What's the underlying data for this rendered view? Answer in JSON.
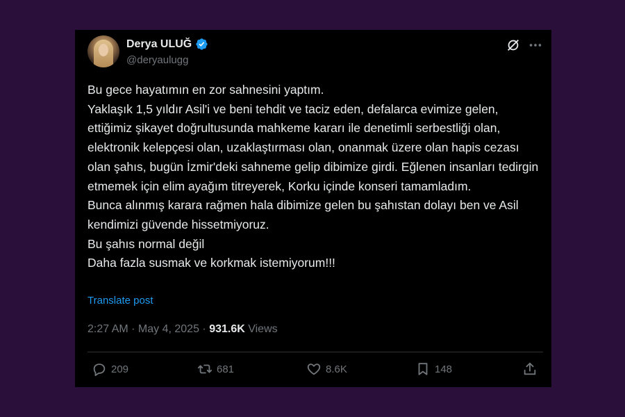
{
  "author": {
    "display_name": "Derya ULUĞ",
    "handle": "@deryaulugg",
    "verified_color": "#1d9bf0"
  },
  "post": {
    "text": "Bu gece hayatımın en zor sahnesini yaptım.\nYaklaşık 1,5 yıldır Asil'i ve beni tehdit ve taciz eden, defalarca evimize gelen, ettiğimiz şikayet doğrultusunda mahkeme kararı ile denetimli serbestliği olan, elektronik kelepçesi olan, uzaklaştırması olan, onanmak üzere olan hapis cezası olan şahıs, bugün İzmir'deki sahneme gelip dibimize girdi. Eğlenen insanları tedirgin etmemek için elim ayağım titreyerek, Korku içinde konseri tamamladım.\nBunca alınmış karara rağmen hala dibimize gelen bu şahıstan dolayı ben ve Asil kendimizi güvende hissetmiyoruz.\nBu şahıs normal değil\nDaha fazla susmak ve korkmak istemiyorum!!!",
    "translate_label": "Translate post",
    "time": "2:27 AM",
    "separator": " · ",
    "date": "May 4, 2025",
    "views_count": "931.6K",
    "views_label": " Views"
  },
  "actions": {
    "replies": "209",
    "reposts": "681",
    "likes": "8.6K",
    "bookmarks": "148"
  },
  "icons": [
    "verified-icon",
    "grok-icon",
    "more-icon",
    "reply-icon",
    "repost-icon",
    "like-icon",
    "bookmark-icon",
    "share-icon"
  ]
}
